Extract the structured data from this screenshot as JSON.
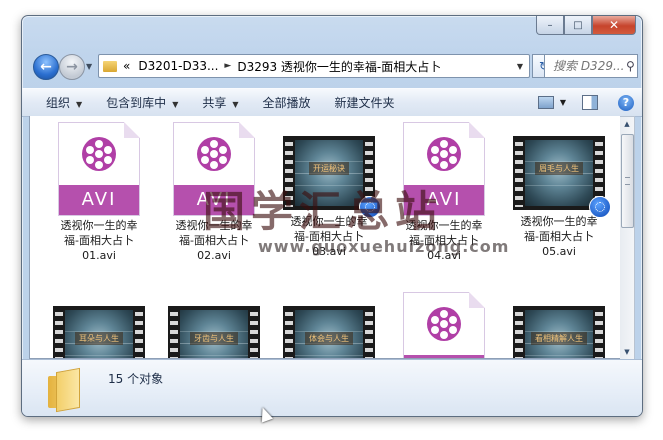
{
  "window": {
    "caption_buttons": {
      "minimize": "–",
      "maximize": "□",
      "close": "✕"
    }
  },
  "nav": {
    "back_glyph": "←",
    "forward_glyph": "→",
    "breadcrumb_prefix": "«",
    "crumb1": "D3201-D33...",
    "crumb_sep": "►",
    "crumb2": "D3293 透视你一生的幸福-面相大占卜",
    "refresh_glyph": "↻",
    "search_placeholder": "搜索 D329...",
    "search_icon": "search-icon"
  },
  "toolbar": {
    "organize": "组织",
    "include_library": "包含到库中",
    "share": "共享",
    "play_all": "全部播放",
    "new_folder": "新建文件夹"
  },
  "files": [
    {
      "type": "avi",
      "line1": "透视你一生的幸",
      "line2": "福-面相大占卜",
      "line3": "01.avi",
      "icon_text": "AVI"
    },
    {
      "type": "avi",
      "line1": "透视你一生的幸",
      "line2": "福-面相大占卜",
      "line3": "02.avi",
      "icon_text": "AVI"
    },
    {
      "type": "film",
      "caption": "开运秘诀",
      "line1": "透视你一生的幸",
      "line2": "福-面相大占卜",
      "line3": "03.avi"
    },
    {
      "type": "avi",
      "line1": "透视你一生的幸",
      "line2": "福-面相大占卜",
      "line3": "04.avi",
      "icon_text": "AVI"
    },
    {
      "type": "film",
      "caption": "眉毛与人生",
      "line1": "透视你一生的幸",
      "line2": "福-面相大占卜",
      "line3": "05.avi"
    },
    {
      "type": "film",
      "caption": "耳朵与人生"
    },
    {
      "type": "film",
      "caption": "牙齿与人生"
    },
    {
      "type": "film",
      "caption": "体会与人生"
    },
    {
      "type": "avi",
      "icon_text": "AVI"
    },
    {
      "type": "film",
      "caption": "看相精解人生"
    }
  ],
  "status": {
    "item_count": "15 个对象"
  },
  "watermark": {
    "text_cn": "国学汇总站",
    "text_url": "www.guoxuehuizong.com"
  }
}
